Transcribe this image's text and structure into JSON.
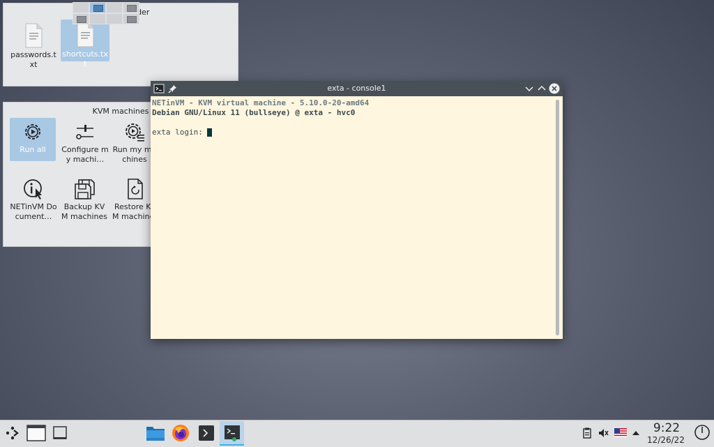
{
  "desktop_folder": {
    "title": "Desktop Folder",
    "items": [
      {
        "label": "passwords.txt",
        "icon": "text-file-icon",
        "selected": false
      },
      {
        "label": "shortcuts.txt",
        "icon": "text-file-icon",
        "selected": true
      }
    ]
  },
  "kvm_folder": {
    "title": "KVM machines",
    "items": [
      {
        "label": "Run all",
        "icon": "gear-play-icon",
        "selected": true
      },
      {
        "label": "Configure my machi…",
        "icon": "sliders-icon"
      },
      {
        "label": "Run my machines",
        "icon": "gear-list-icon"
      },
      {
        "label": "NETinVM Document…",
        "icon": "info-icon"
      },
      {
        "label": "Backup KVM machines",
        "icon": "floppy-icon"
      },
      {
        "label": "Restore KVM machines",
        "icon": "document-restore-icon"
      }
    ]
  },
  "terminal": {
    "window_title": "exta - console1",
    "lines": [
      "NETinVM - KVM virtual machine - 5.10.0-20-amd64",
      "Debian GNU/Linux 11 (bullseye) @ exta - hvc0",
      "",
      "exta login: "
    ]
  },
  "taskbar": {
    "clock_time": "9:22",
    "clock_date": "12/26/22",
    "accent_color": "#3daee9"
  }
}
